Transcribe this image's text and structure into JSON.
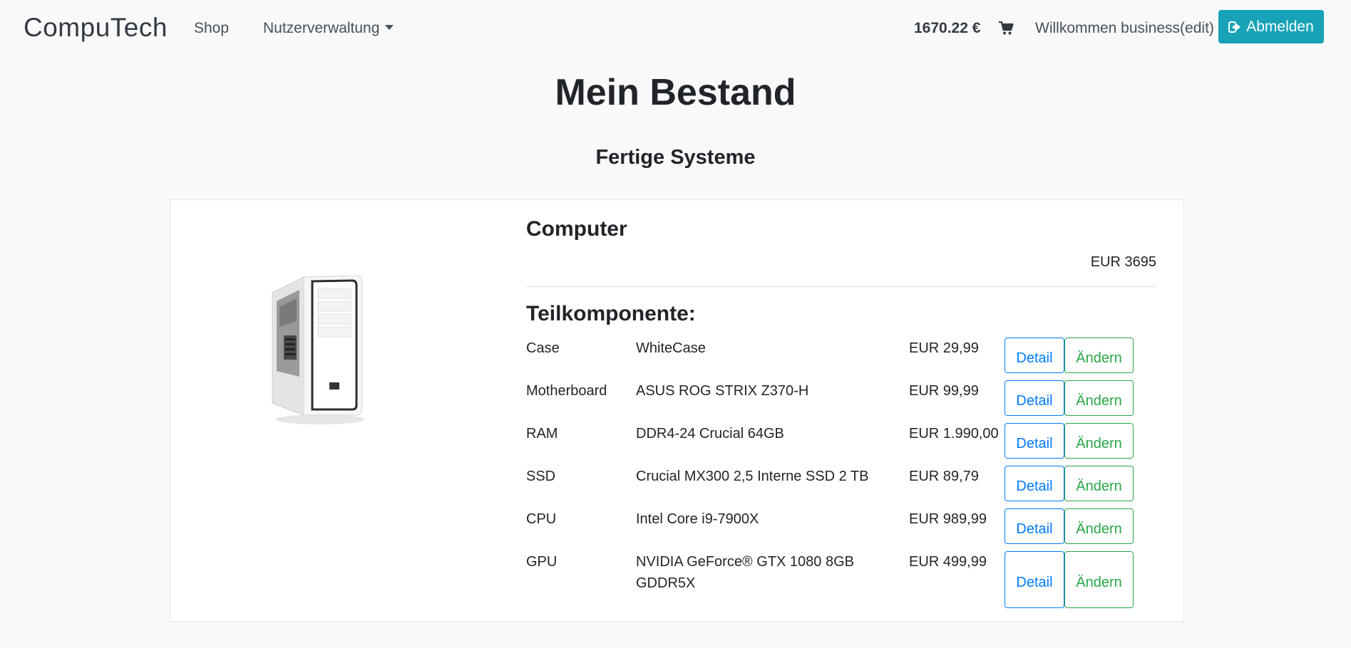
{
  "navbar": {
    "brand": "CompuTech",
    "shop_label": "Shop",
    "users_label": "Nutzerverwaltung",
    "balance": "1670.22 €",
    "cart_icon": "shopping-cart-icon",
    "welcome": "Willkommen business(edit)",
    "logout_label": "Abmelden",
    "logout_icon": "sign-out-icon"
  },
  "page": {
    "title": "Mein Bestand",
    "section_title": "Fertige Systeme"
  },
  "product": {
    "name": "Computer",
    "price": "EUR 3695",
    "components_title": "Teilkomponente:",
    "components": [
      {
        "type": "Case",
        "name": "WhiteCase",
        "price": "EUR 29,99",
        "detail_label": "Detail",
        "edit_label": "Ändern"
      },
      {
        "type": "Motherboard",
        "name": "ASUS ROG STRIX Z370-H",
        "price": "EUR 99,99",
        "detail_label": "Detail",
        "edit_label": "Ändern"
      },
      {
        "type": "RAM",
        "name": "DDR4-24 Crucial 64GB",
        "price": "EUR 1.990,00",
        "detail_label": "Detail",
        "edit_label": "Ändern"
      },
      {
        "type": "SSD",
        "name": "Crucial MX300 2,5 Interne SSD 2 TB",
        "price": "EUR 89,79",
        "detail_label": "Detail",
        "edit_label": "Ändern"
      },
      {
        "type": "CPU",
        "name": "Intel Core i9-7900X",
        "price": "EUR 989,99",
        "detail_label": "Detail",
        "edit_label": "Ändern"
      },
      {
        "type": "GPU",
        "name": "NVIDIA GeForce® GTX 1080 8GB GDDR5X",
        "price": "EUR 499,99",
        "detail_label": "Detail",
        "edit_label": "Ändern"
      }
    ]
  },
  "colors": {
    "background": "#f8f9fa",
    "info": "#17a2b8",
    "primary": "#007bff",
    "success": "#28a745"
  }
}
